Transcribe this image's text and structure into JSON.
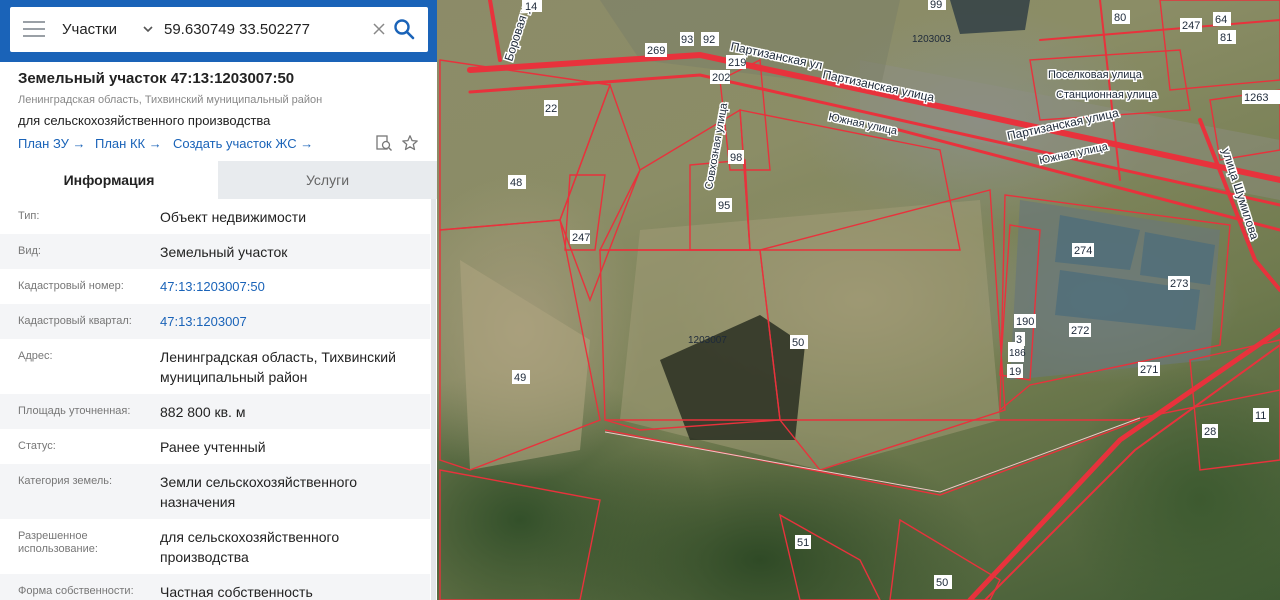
{
  "search": {
    "mode": "Участки",
    "query": "59.630749 33.502277"
  },
  "parcel": {
    "title": "Земельный участок 47:13:1203007:50",
    "region": "Ленинградская область, Тихвинский муниципальный район",
    "usage": "для сельскохозяйственного производства",
    "links": [
      "План ЗУ",
      "План КК",
      "Создать участок ЖС"
    ]
  },
  "tabs": [
    "Информация",
    "Услуги"
  ],
  "info": [
    {
      "label": "Тип:",
      "value": "Объект недвижимости"
    },
    {
      "label": "Вид:",
      "value": "Земельный участок"
    },
    {
      "label": "Кадастровый номер:",
      "value": "47:13:1203007:50"
    },
    {
      "label": "Кадастровый квартал:",
      "value": "47:13:1203007"
    },
    {
      "label": "Адрес:",
      "value1": "Ленинградская область, Тихвинский",
      "value2": "муниципальный район"
    },
    {
      "label": "Площадь уточненная:",
      "value": "882 800 кв. м"
    },
    {
      "label": "Статус:",
      "value": "Ранее учтенный"
    },
    {
      "label": "Категория земель:",
      "value1": "Земли сельскохозяйственного",
      "value2": "назначения"
    },
    {
      "label1": "Разрешенное",
      "label2": "использование:",
      "value1": "для сельскохозяйственного",
      "value2": "производства"
    },
    {
      "label": "Форма собственности:",
      "value": "Частная собственность"
    }
  ],
  "map": {
    "streets": [
      "Боровая улица",
      "Партизанская ул",
      "Партизанская улица",
      "Партизанская улица",
      "Южная улица",
      "Южная улица",
      "Совхозная улица",
      "Поселковая улица",
      "Станционная улица",
      "улица Шумилова"
    ],
    "block_label": "1203003",
    "quarter_label": "1203007",
    "parcel_numbers": [
      "14",
      "269",
      "93",
      "92",
      "219",
      "202",
      "22",
      "98",
      "95",
      "48",
      "247",
      "49",
      "50",
      "51",
      "50",
      "274",
      "273",
      "272",
      "271",
      "190",
      "186",
      "3",
      "19",
      "28",
      "11",
      "80",
      "64",
      "81",
      "247",
      "99",
      "1263"
    ],
    "colors": {
      "boundary": "#e8323c",
      "road": "#e8323c",
      "label_bg": "#ffffff"
    }
  },
  "colors": {
    "header": "#1a63b8",
    "link": "#1a63b8",
    "accent": "#1a63b8"
  }
}
